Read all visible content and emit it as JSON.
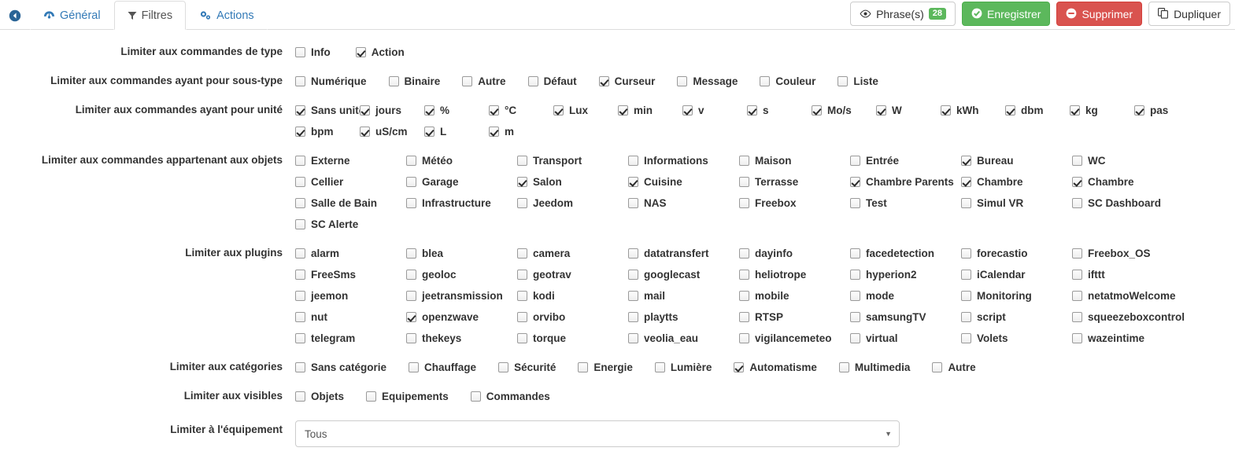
{
  "header": {
    "back_icon": "back-arrow-icon",
    "tabs": [
      {
        "label": "Général",
        "icon": "dashboard-icon",
        "active": false
      },
      {
        "label": "Filtres",
        "icon": "filter-icon",
        "active": true
      },
      {
        "label": "Actions",
        "icon": "cogs-icon",
        "active": false
      }
    ],
    "buttons": {
      "phrases": {
        "label": "Phrase(s)",
        "icon": "eye-icon",
        "count": "28"
      },
      "save": {
        "label": "Enregistrer",
        "icon": "check-circle-icon"
      },
      "delete": {
        "label": "Supprimer",
        "icon": "minus-circle-icon"
      },
      "duplicate": {
        "label": "Dupliquer",
        "icon": "copy-icon"
      }
    }
  },
  "colors": {
    "link": "#337ab7",
    "success": "#5cb85c",
    "danger": "#d9534f",
    "border": "#dddddd"
  },
  "form": {
    "type": {
      "label": "Limiter aux commandes de type",
      "items": [
        {
          "label": "Info",
          "checked": false
        },
        {
          "label": "Action",
          "checked": true
        }
      ]
    },
    "subtype": {
      "label": "Limiter aux commandes ayant pour sous-type",
      "items": [
        {
          "label": "Numérique",
          "checked": false
        },
        {
          "label": "Binaire",
          "checked": false
        },
        {
          "label": "Autre",
          "checked": false
        },
        {
          "label": "Défaut",
          "checked": false
        },
        {
          "label": "Curseur",
          "checked": true
        },
        {
          "label": "Message",
          "checked": false
        },
        {
          "label": "Couleur",
          "checked": false
        },
        {
          "label": "Liste",
          "checked": false
        }
      ]
    },
    "unit": {
      "label": "Limiter aux commandes ayant pour unité",
      "items": [
        {
          "label": "Sans unité",
          "checked": true
        },
        {
          "label": "jours",
          "checked": true
        },
        {
          "label": "%",
          "checked": true
        },
        {
          "label": "°C",
          "checked": true
        },
        {
          "label": "Lux",
          "checked": true
        },
        {
          "label": "min",
          "checked": true
        },
        {
          "label": "v",
          "checked": true
        },
        {
          "label": "s",
          "checked": true
        },
        {
          "label": "Mo/s",
          "checked": true
        },
        {
          "label": "W",
          "checked": true
        },
        {
          "label": "kWh",
          "checked": true
        },
        {
          "label": "dbm",
          "checked": true
        },
        {
          "label": "kg",
          "checked": true
        },
        {
          "label": "pas",
          "checked": true
        },
        {
          "label": "bpm",
          "checked": true
        },
        {
          "label": "uS/cm",
          "checked": true
        },
        {
          "label": "L",
          "checked": true
        },
        {
          "label": "m",
          "checked": true
        }
      ]
    },
    "objects": {
      "label": "Limiter aux commandes appartenant aux objets",
      "items": [
        {
          "label": "Externe",
          "checked": false
        },
        {
          "label": "Météo",
          "checked": false
        },
        {
          "label": "Transport",
          "checked": false
        },
        {
          "label": "Informations",
          "checked": false
        },
        {
          "label": "Maison",
          "checked": false
        },
        {
          "label": "Entrée",
          "checked": false
        },
        {
          "label": "Bureau",
          "checked": true
        },
        {
          "label": "WC",
          "checked": false
        },
        {
          "label": "Cellier",
          "checked": false
        },
        {
          "label": "Garage",
          "checked": false
        },
        {
          "label": "Salon",
          "checked": true
        },
        {
          "label": "Cuisine",
          "checked": true
        },
        {
          "label": "Terrasse",
          "checked": false
        },
        {
          "label": "Chambre Parents",
          "checked": true
        },
        {
          "label": "Chambre",
          "checked": true
        },
        {
          "label": "Chambre",
          "checked": true
        },
        {
          "label": "Salle de Bain",
          "checked": false
        },
        {
          "label": "Infrastructure",
          "checked": false
        },
        {
          "label": "Jeedom",
          "checked": false
        },
        {
          "label": "NAS",
          "checked": false
        },
        {
          "label": "Freebox",
          "checked": false
        },
        {
          "label": "Test",
          "checked": false
        },
        {
          "label": "Simul VR",
          "checked": false
        },
        {
          "label": "SC Dashboard",
          "checked": false
        },
        {
          "label": "SC Alerte",
          "checked": false
        }
      ]
    },
    "plugins": {
      "label": "Limiter aux plugins",
      "items": [
        {
          "label": "alarm",
          "checked": false
        },
        {
          "label": "blea",
          "checked": false
        },
        {
          "label": "camera",
          "checked": false
        },
        {
          "label": "datatransfert",
          "checked": false
        },
        {
          "label": "dayinfo",
          "checked": false
        },
        {
          "label": "facedetection",
          "checked": false
        },
        {
          "label": "forecastio",
          "checked": false
        },
        {
          "label": "Freebox_OS",
          "checked": false
        },
        {
          "label": "FreeSms",
          "checked": false
        },
        {
          "label": "geoloc",
          "checked": false
        },
        {
          "label": "geotrav",
          "checked": false
        },
        {
          "label": "googlecast",
          "checked": false
        },
        {
          "label": "heliotrope",
          "checked": false
        },
        {
          "label": "hyperion2",
          "checked": false
        },
        {
          "label": "iCalendar",
          "checked": false
        },
        {
          "label": "ifttt",
          "checked": false
        },
        {
          "label": "jeemon",
          "checked": false
        },
        {
          "label": "jeetransmission",
          "checked": false
        },
        {
          "label": "kodi",
          "checked": false
        },
        {
          "label": "mail",
          "checked": false
        },
        {
          "label": "mobile",
          "checked": false
        },
        {
          "label": "mode",
          "checked": false
        },
        {
          "label": "Monitoring",
          "checked": false
        },
        {
          "label": "netatmoWelcome",
          "checked": false
        },
        {
          "label": "nut",
          "checked": false
        },
        {
          "label": "openzwave",
          "checked": true
        },
        {
          "label": "orvibo",
          "checked": false
        },
        {
          "label": "playtts",
          "checked": false
        },
        {
          "label": "RTSP",
          "checked": false
        },
        {
          "label": "samsungTV",
          "checked": false
        },
        {
          "label": "script",
          "checked": false
        },
        {
          "label": "squeezeboxcontrol",
          "checked": false
        },
        {
          "label": "telegram",
          "checked": false
        },
        {
          "label": "thekeys",
          "checked": false
        },
        {
          "label": "torque",
          "checked": false
        },
        {
          "label": "veolia_eau",
          "checked": false
        },
        {
          "label": "vigilancemeteo",
          "checked": false
        },
        {
          "label": "virtual",
          "checked": false
        },
        {
          "label": "Volets",
          "checked": false
        },
        {
          "label": "wazeintime",
          "checked": false
        }
      ]
    },
    "categories": {
      "label": "Limiter aux catégories",
      "items": [
        {
          "label": "Sans catégorie",
          "checked": false
        },
        {
          "label": "Chauffage",
          "checked": false
        },
        {
          "label": "Sécurité",
          "checked": false
        },
        {
          "label": "Energie",
          "checked": false
        },
        {
          "label": "Lumière",
          "checked": false
        },
        {
          "label": "Automatisme",
          "checked": true
        },
        {
          "label": "Multimedia",
          "checked": false
        },
        {
          "label": "Autre",
          "checked": false
        }
      ]
    },
    "visibles": {
      "label": "Limiter aux visibles",
      "items": [
        {
          "label": "Objets",
          "checked": false
        },
        {
          "label": "Equipements",
          "checked": false
        },
        {
          "label": "Commandes",
          "checked": false
        }
      ]
    },
    "equipment": {
      "label": "Limiter à l'équipement",
      "value": "Tous",
      "caret": "chevron-down-icon"
    }
  }
}
